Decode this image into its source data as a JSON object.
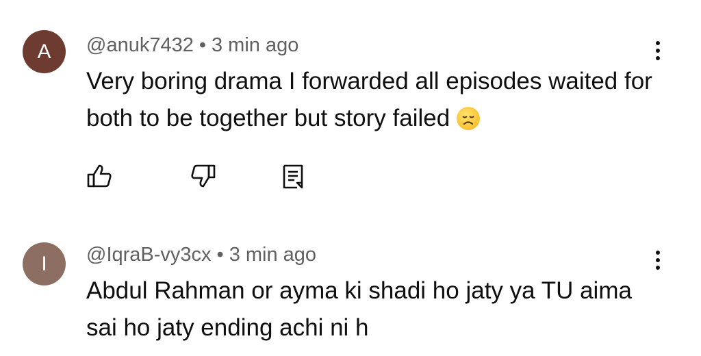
{
  "comments": [
    {
      "avatar_letter": "A",
      "avatar_color": "#6d3b2f",
      "username": "@anuk7432",
      "separator": "•",
      "time": "3 min ago",
      "text": "Very boring drama I forwarded all episodes waited for both to be together but story failed",
      "emoji": "disappointed-face-emoji"
    },
    {
      "avatar_letter": "I",
      "avatar_color": "#8d6e63",
      "username": "@IqraB-vy3cx",
      "separator": "•",
      "time": "3 min ago",
      "text": "Abdul Rahman or ayma ki shadi ho jaty ya TU aima sai ho jaty ending achi ni h"
    }
  ],
  "actions": {
    "like_icon": "thumbs-up-icon",
    "dislike_icon": "thumbs-down-icon",
    "reply_icon": "reply-comment-icon"
  }
}
